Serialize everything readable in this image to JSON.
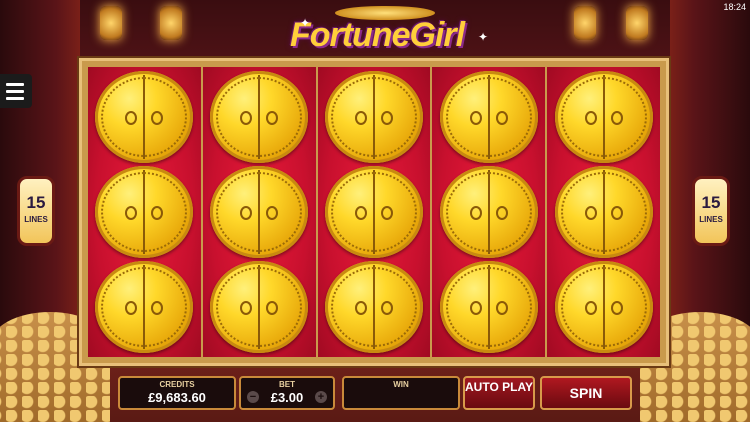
{
  "status_bar": {
    "time": "18:24"
  },
  "game": {
    "title": "FortuneGirl"
  },
  "lines": {
    "left_value": "15",
    "left_label": "LINES",
    "right_value": "15",
    "right_label": "LINES"
  },
  "reels": {
    "columns": 5,
    "rows": 3,
    "symbol": "golden-door"
  },
  "controls": {
    "credits_label": "CREDITS",
    "credits_value": "£9,683.60",
    "bet_label": "BET",
    "bet_value": "£3.00",
    "bet_minus": "−",
    "bet_plus": "+",
    "win_label": "WIN",
    "win_value": "",
    "autoplay_label": "AUTO PLAY",
    "spin_label": "SPIN"
  },
  "colors": {
    "reel_bg": "#c8102e",
    "frame": "#c99a4c",
    "door_gold": "#ffd82a"
  }
}
